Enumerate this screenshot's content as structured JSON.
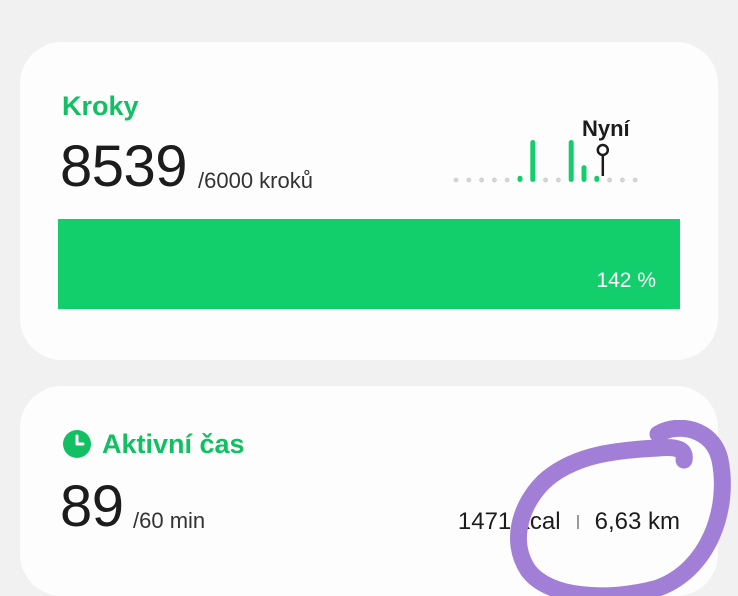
{
  "steps_card": {
    "title": "Kroky",
    "value": "8539",
    "goal": "/6000 kroků",
    "now_label": "Nyní",
    "progress_percent_label": "142 %",
    "progress_fraction": 1.0,
    "hourly_levels": [
      0,
      0,
      0,
      0,
      0,
      0.15,
      1.0,
      0,
      0,
      1.0,
      0.4,
      0.15,
      0,
      0,
      0
    ],
    "current_index": 11
  },
  "active_card": {
    "title": "Aktivní čas",
    "value": "89",
    "goal": "/60 min",
    "calories": "1471 kcal",
    "distance": "6,63 km"
  },
  "colors": {
    "accent": "#10c062",
    "bar": "#13cf6b",
    "annotation": "#a27fd6"
  }
}
